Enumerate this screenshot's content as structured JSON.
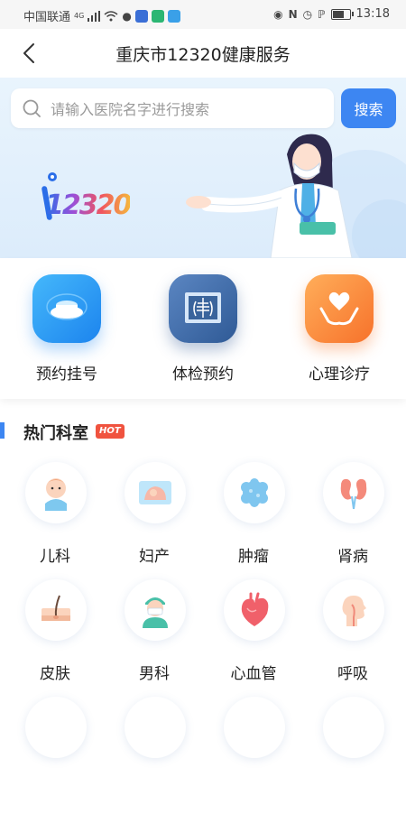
{
  "status_bar": {
    "carrier": "中国联通",
    "network": "4G",
    "time": "13:18"
  },
  "nav": {
    "title": "重庆市12320健康服务",
    "back_icon": "chevron-left-icon"
  },
  "search": {
    "placeholder": "请输入医院名字进行搜索",
    "value": "",
    "button_label": "搜索"
  },
  "hero": {
    "logo_text": "12320"
  },
  "services": [
    {
      "label": "预约挂号",
      "icon": "registration-icon",
      "color": "#2a9cf5"
    },
    {
      "label": "体检预约",
      "icon": "xray-icon",
      "color": "#3b67a6"
    },
    {
      "label": "心理诊疗",
      "icon": "heart-hands-icon",
      "color": "#fb8a3c"
    }
  ],
  "section": {
    "title": "热门科室",
    "badge": "HOT"
  },
  "departments": [
    {
      "label": "儿科",
      "icon": "baby-icon"
    },
    {
      "label": "妇产",
      "icon": "ultrasound-icon"
    },
    {
      "label": "肿瘤",
      "icon": "tumor-icon"
    },
    {
      "label": "肾病",
      "icon": "kidney-icon"
    },
    {
      "label": "皮肤",
      "icon": "skin-icon"
    },
    {
      "label": "男科",
      "icon": "male-doctor-icon"
    },
    {
      "label": "心血管",
      "icon": "heart-icon"
    },
    {
      "label": "呼吸",
      "icon": "respiratory-icon"
    }
  ],
  "colors": {
    "accent": "#3d86f2",
    "hot": "#f0533f"
  }
}
